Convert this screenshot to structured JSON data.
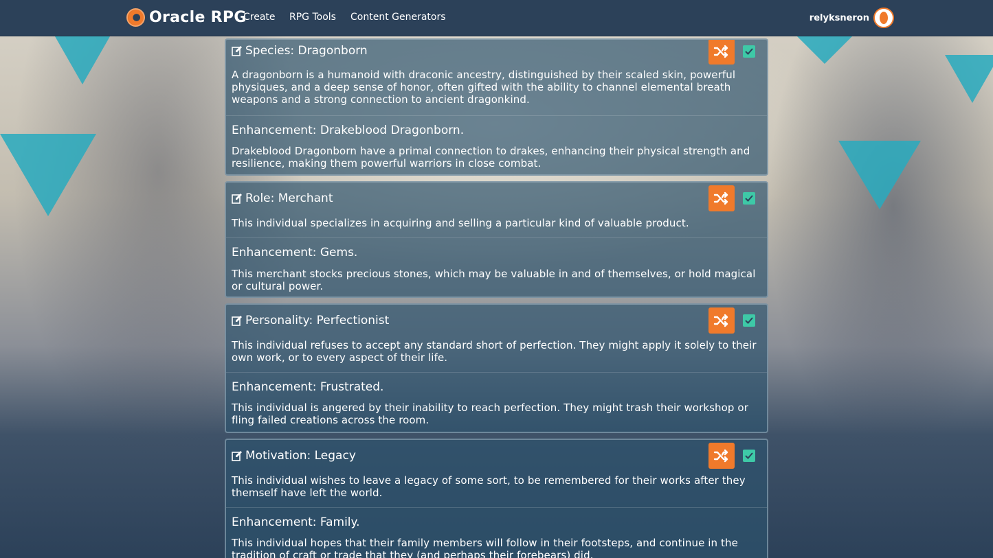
{
  "app": {
    "name": "Oracle RPG",
    "nav": [
      "Create",
      "RPG Tools",
      "Content Generators"
    ],
    "username": "relyksneron"
  },
  "colors": {
    "header_bg": "#2c4159",
    "accent_orange": "#f07a2b",
    "check_green": "#3ec9a7",
    "card_bg": "#2c536d"
  },
  "icons": {
    "edit": "edit-icon",
    "shuffle": "shuffle-icon",
    "check": "check-icon"
  },
  "cards": [
    {
      "title": "Species: Dragonborn",
      "description": "A dragonborn is a humanoid with draconic ancestry, distinguished by their scaled skin, powerful physiques, and a deep sense of honor, often gifted with the ability to channel elemental breath weapons and a strong connection to ancient dragonkind.",
      "enhancement_title": "Enhancement: Drakeblood Dragonborn.",
      "enhancement_description": "Drakeblood Dragonborn have a primal connection to drakes, enhancing their physical strength and resilience, making them powerful warriors in close combat.",
      "checked": true
    },
    {
      "title": "Role: Merchant",
      "description": "This individual specializes in acquiring and selling a particular kind of valuable product.",
      "enhancement_title": "Enhancement: Gems.",
      "enhancement_description": "This merchant stocks precious stones, which may be valuable in and of themselves, or hold magical or cultural power.",
      "checked": true
    },
    {
      "title": "Personality: Perfectionist",
      "description": "This individual refuses to accept any standard short of perfection. They might apply it solely to their own work, or to every aspect of their life.",
      "enhancement_title": "Enhancement: Frustrated.",
      "enhancement_description": "This individual is angered by their inability to reach perfection. They might trash their workshop or fling failed creations across the room.",
      "checked": true
    },
    {
      "title": "Motivation: Legacy",
      "description": "This individual wishes to leave a legacy of some sort, to be remembered for their works after they themself have left the world.",
      "enhancement_title": "Enhancement: Family.",
      "enhancement_description": "This individual hopes that their family members will follow in their footsteps, and continue in the tradition of craft or trade that they (and perhaps their forebears) did.",
      "checked": true
    }
  ]
}
